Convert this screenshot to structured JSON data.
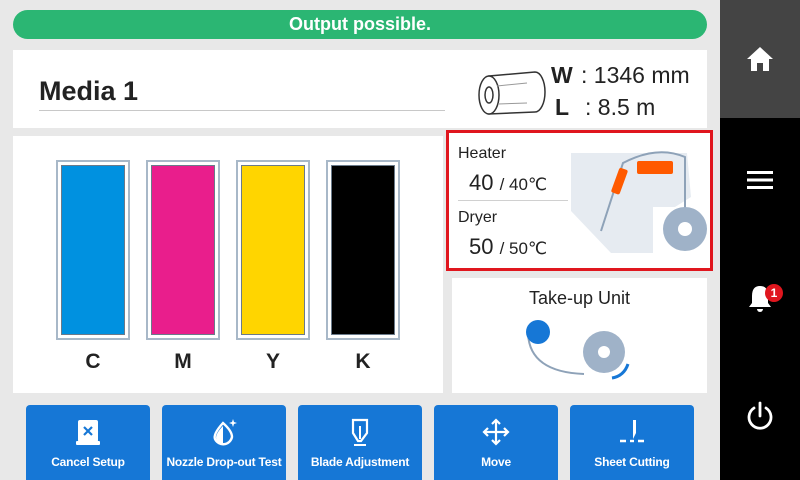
{
  "status": {
    "message": "Output possible.",
    "color": "#2bb673"
  },
  "media": {
    "name": "Media 1",
    "icon": "media-roll-icon",
    "width_label": "W",
    "width_value": ": 1346 mm",
    "length_label": "L",
    "length_value": ": 8.5 m"
  },
  "inks": [
    {
      "label": "C",
      "color": "#0091e0",
      "level": 1.0
    },
    {
      "label": "M",
      "color": "#e91e8c",
      "level": 1.0
    },
    {
      "label": "Y",
      "color": "#ffd500",
      "level": 1.0
    },
    {
      "label": "K",
      "color": "#000000",
      "level": 1.0
    }
  ],
  "heater": {
    "heater_label": "Heater",
    "heater_current": "40",
    "heater_target": "/ 40℃",
    "dryer_label": "Dryer",
    "dryer_current": "50",
    "dryer_target": "/ 50℃",
    "highlight_color": "#e0161e",
    "heater_element_color": "#ff5a00"
  },
  "takeup": {
    "title": "Take-up Unit"
  },
  "actions": [
    {
      "label": "Cancel Setup",
      "icon": "cancel-setup-icon"
    },
    {
      "label": "Nozzle Drop-out Test",
      "icon": "nozzle-test-icon"
    },
    {
      "label": "Blade Adjustment",
      "icon": "blade-icon"
    },
    {
      "label": "Move",
      "icon": "move-arrows-icon"
    },
    {
      "label": "Sheet Cutting",
      "icon": "sheet-cut-icon"
    }
  ],
  "nav": {
    "items": [
      "home-icon",
      "menu-icon",
      "bell-icon",
      "power-icon"
    ],
    "notification_count": "1",
    "accent": "#1677d6"
  }
}
